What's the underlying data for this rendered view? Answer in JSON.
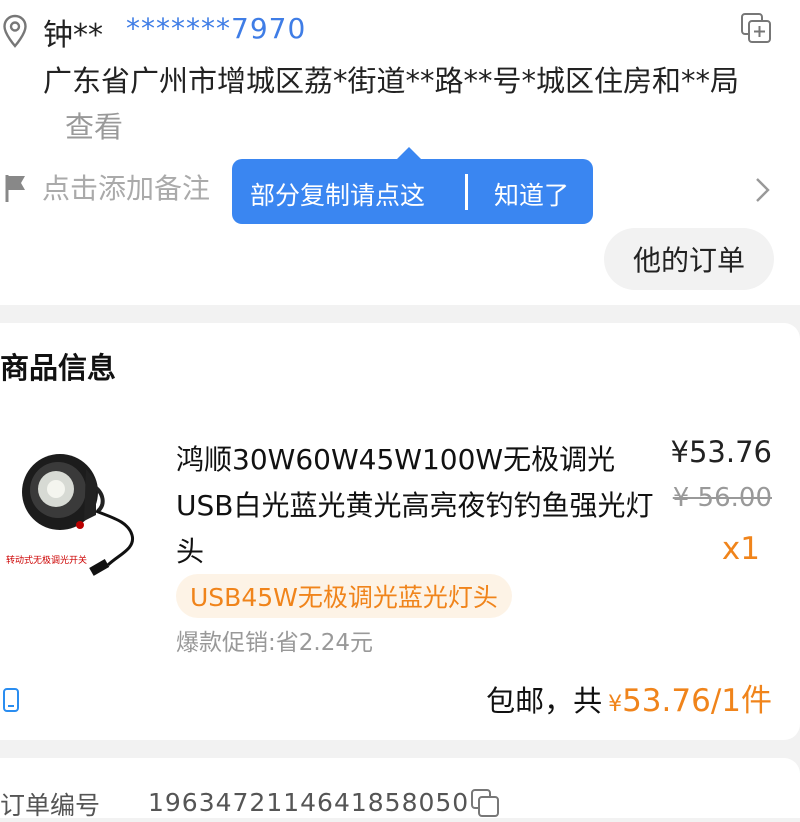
{
  "address_card": {
    "name": "钟**",
    "phone": "*******7970",
    "address": "广东省广州市增城区荔*街道**路**号*城区住房和**局",
    "view_label": "查看",
    "note_placeholder": "点击添加备注",
    "tooltip": {
      "copy_hint": "部分复制请点这",
      "ok_label": "知道了"
    },
    "his_orders_label": "他的订单"
  },
  "goods_card": {
    "section_title": "商品信息",
    "product": {
      "title": "鸿顺30W60W45W100W无极调光USB白光蓝光黄光高亮夜钓钓鱼强光灯头",
      "price": "¥53.76",
      "original_price": "¥ 56.00",
      "quantity": "x1",
      "sku": "USB45W无极调光蓝光灯头",
      "promo": "爆款促销:省2.24元",
      "thumbnail_caption": "转动式无极调光开关"
    },
    "total": {
      "label": "包邮，共",
      "currency": "¥",
      "amount": "53.76/1件"
    }
  },
  "order_card": {
    "order_label": "订单编号",
    "order_number": "1963472114641858050"
  },
  "colors": {
    "accent_blue": "#3a86f1",
    "price_orange": "#f0841b",
    "muted_gray": "#999999"
  }
}
